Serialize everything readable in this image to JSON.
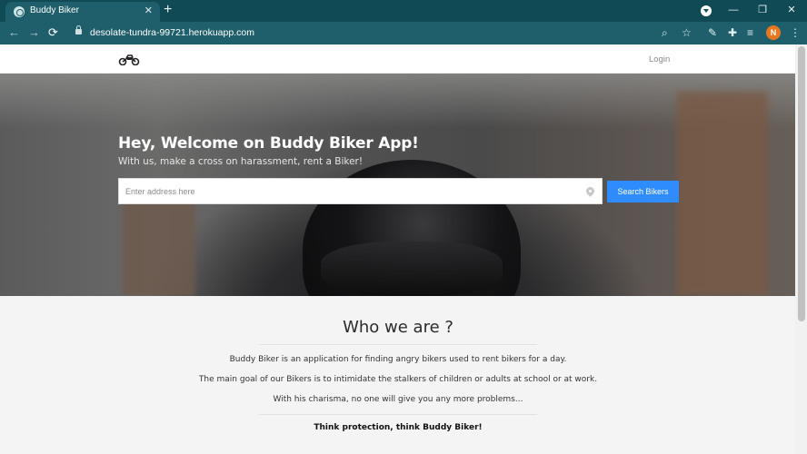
{
  "browser": {
    "tab_title": "Buddy Biker",
    "tab_close": "✕",
    "new_tab": "+",
    "url": "desolate-tundra-99721.herokuapp.com",
    "profile_initial": "N",
    "nav": {
      "back": "←",
      "forward": "→",
      "reload": "⟳"
    },
    "window": {
      "minimize": "—",
      "maximize": "❐",
      "close": "✕"
    },
    "toolbar_icons": {
      "zoom": "⌕",
      "bookmark": "☆",
      "extension_pen": "✎",
      "extensions": "✚",
      "reading_list": "≡",
      "menu": "⋮"
    },
    "accent": "#1e5f6b"
  },
  "site": {
    "nav": {
      "login": "Login"
    },
    "hero": {
      "title": "Hey, Welcome on Buddy Biker App!",
      "subtitle": "With us, make a cross on harassment, rent a Biker!",
      "search_placeholder": "Enter address here",
      "search_button": "Search Bikers"
    },
    "about": {
      "title": "Who we are ?",
      "lines": [
        "Buddy Biker is an application for finding angry bikers used to rent bikers for a day.",
        "The main goal of our Bikers is to intimidate the stalkers of children or adults at school or at work.",
        "With his charisma, no one will give you any more problems..."
      ],
      "tagline": "Think protection, think Buddy Biker!"
    },
    "colors": {
      "button": "#2f8cff",
      "nav_bg": "#ffffff",
      "about_bg": "#f4f4f4"
    }
  }
}
